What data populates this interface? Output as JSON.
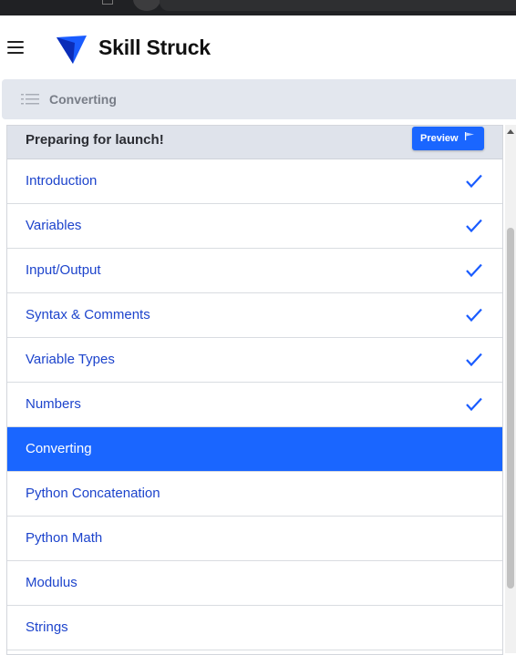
{
  "app": {
    "brand_name": "Skill Struck",
    "accent_color": "#1a66ff",
    "link_color": "#1d44cc"
  },
  "header": {
    "menu_icon": "hamburger-menu-icon",
    "logo_icon": "skill-struck-logo-icon"
  },
  "breadcrumb": {
    "icon": "list-icon",
    "current": "Converting"
  },
  "panel": {
    "title": "Preparing for launch!",
    "preview_label": "Preview",
    "preview_icon": "flag-icon"
  },
  "lessons": [
    {
      "label": "Introduction",
      "completed": true,
      "active": false
    },
    {
      "label": "Variables",
      "completed": true,
      "active": false
    },
    {
      "label": "Input/Output",
      "completed": true,
      "active": false
    },
    {
      "label": "Syntax & Comments",
      "completed": true,
      "active": false
    },
    {
      "label": "Variable Types",
      "completed": true,
      "active": false
    },
    {
      "label": "Numbers",
      "completed": true,
      "active": false
    },
    {
      "label": "Converting",
      "completed": false,
      "active": true
    },
    {
      "label": "Python Concatenation",
      "completed": false,
      "active": false
    },
    {
      "label": "Python Math",
      "completed": false,
      "active": false
    },
    {
      "label": "Modulus",
      "completed": false,
      "active": false
    },
    {
      "label": "Strings",
      "completed": false,
      "active": false
    }
  ]
}
